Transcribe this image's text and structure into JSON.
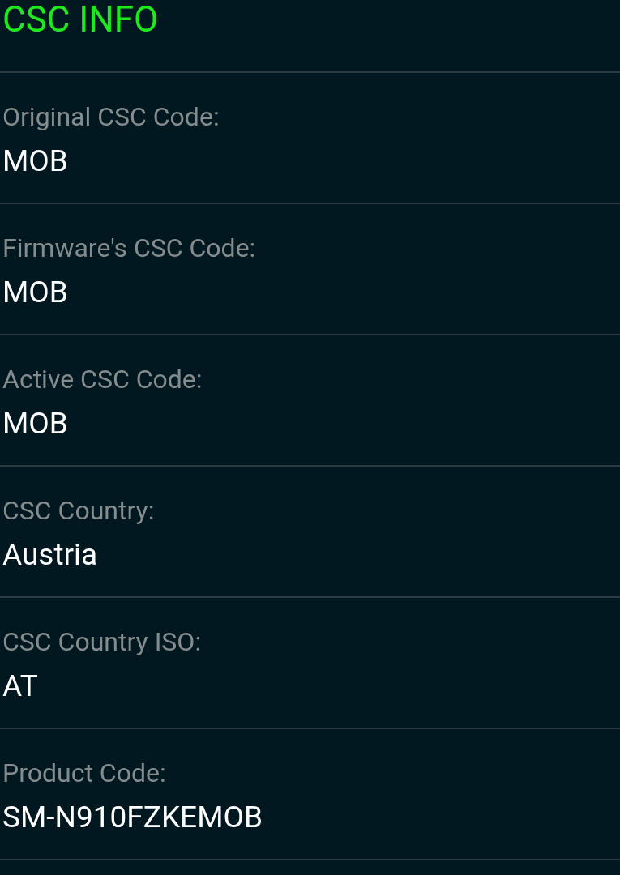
{
  "title": "CSC INFO",
  "rows": [
    {
      "label": "Original CSC Code:",
      "value": "MOB"
    },
    {
      "label": "Firmware's CSC Code:",
      "value": "MOB"
    },
    {
      "label": "Active CSC Code:",
      "value": "MOB"
    },
    {
      "label": "CSC Country:",
      "value": "Austria"
    },
    {
      "label": "CSC Country ISO:",
      "value": "AT"
    },
    {
      "label": "Product Code:",
      "value": "SM-N910FZKEMOB"
    }
  ]
}
